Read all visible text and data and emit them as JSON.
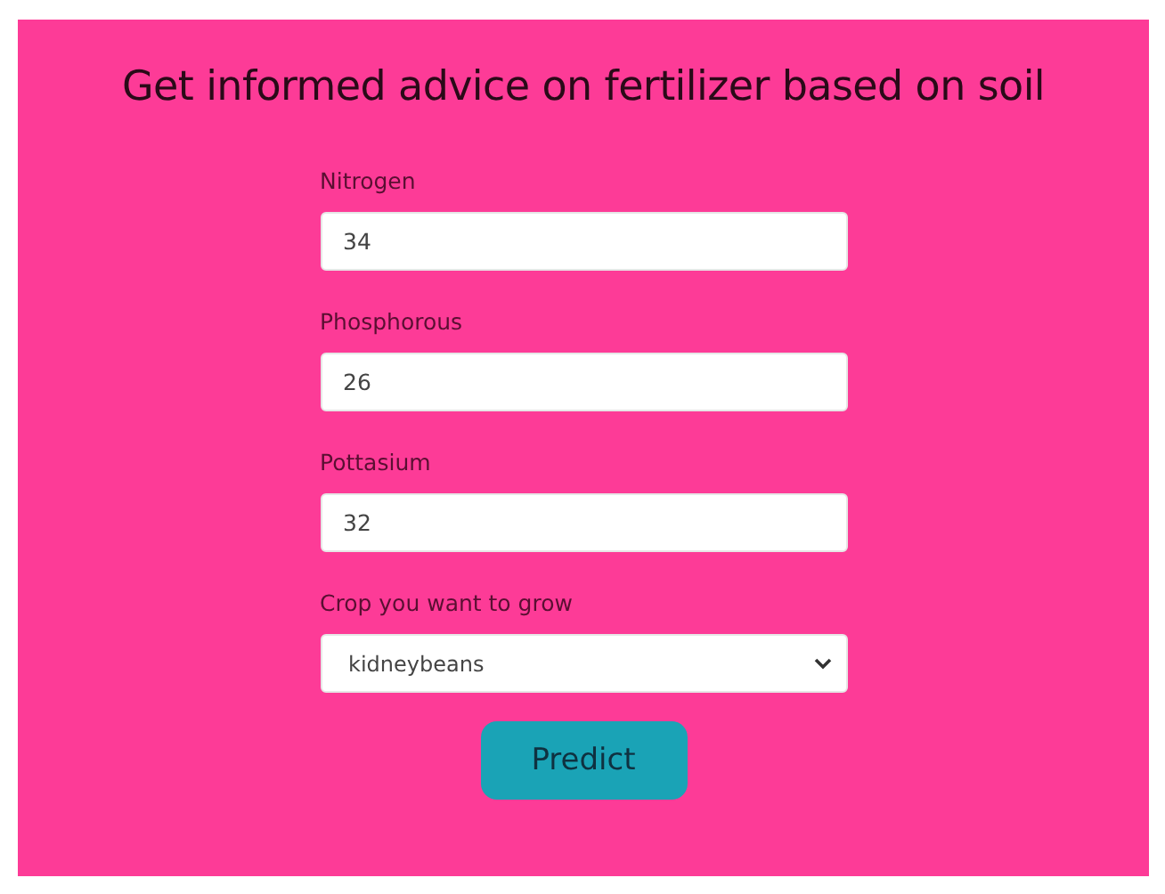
{
  "title": "Get informed advice on fertilizer based on soil",
  "fields": [
    {
      "kind": "input",
      "label": "Nitrogen",
      "value": "34"
    },
    {
      "kind": "input",
      "label": "Phosphorous",
      "value": "26"
    },
    {
      "kind": "input",
      "label": "Pottasium",
      "value": "32"
    },
    {
      "kind": "select",
      "label": "Crop you want to grow",
      "value": "kidneybeans"
    }
  ],
  "button": "Predict"
}
